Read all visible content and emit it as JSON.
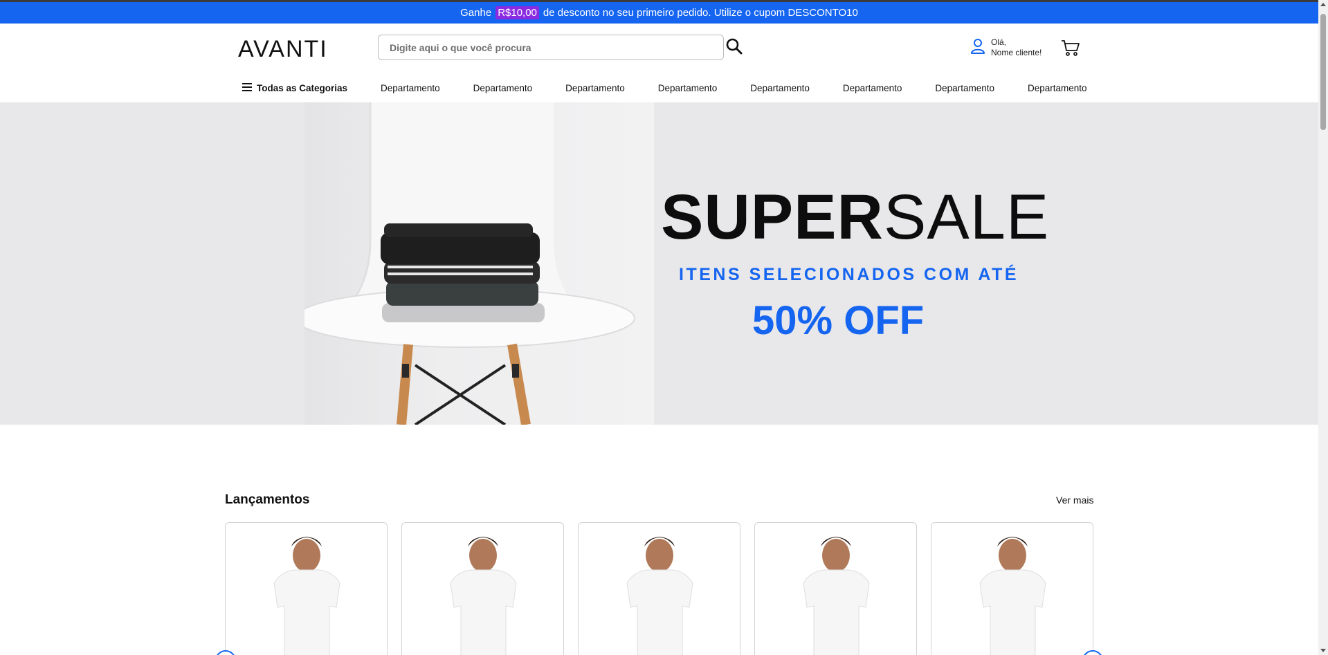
{
  "promo": {
    "prefix": "Ganhe",
    "amount": "R$10,00",
    "suffix": "de desconto no seu primeiro pedido. Utilize o cupom DESCONTO10"
  },
  "header": {
    "logo": "AVANTI",
    "search_placeholder": "Digite aqui o que você procura",
    "search_icon": "search-icon",
    "user_greeting": "Olá,",
    "user_name": "Nome cliente!",
    "user_icon": "user-icon",
    "cart_icon": "cart-icon"
  },
  "nav": {
    "all_categories": "Todas as Categorias",
    "menu_icon": "hamburger-icon",
    "departments": [
      "Departamento",
      "Departamento",
      "Departamento",
      "Departamento",
      "Departamento",
      "Departamento",
      "Departamento",
      "Departamento"
    ]
  },
  "hero": {
    "title_bold": "SUPER",
    "title_light": "SALE",
    "subtitle": "ITENS SELECIONADOS COM ATÉ",
    "discount": "50% OFF",
    "image": "folded clothes on white chair"
  },
  "section": {
    "title": "Lançamentos",
    "see_more": "Ver mais"
  },
  "colors": {
    "brand_blue": "#1565f0",
    "promo_highlight": "#8a2be2"
  }
}
